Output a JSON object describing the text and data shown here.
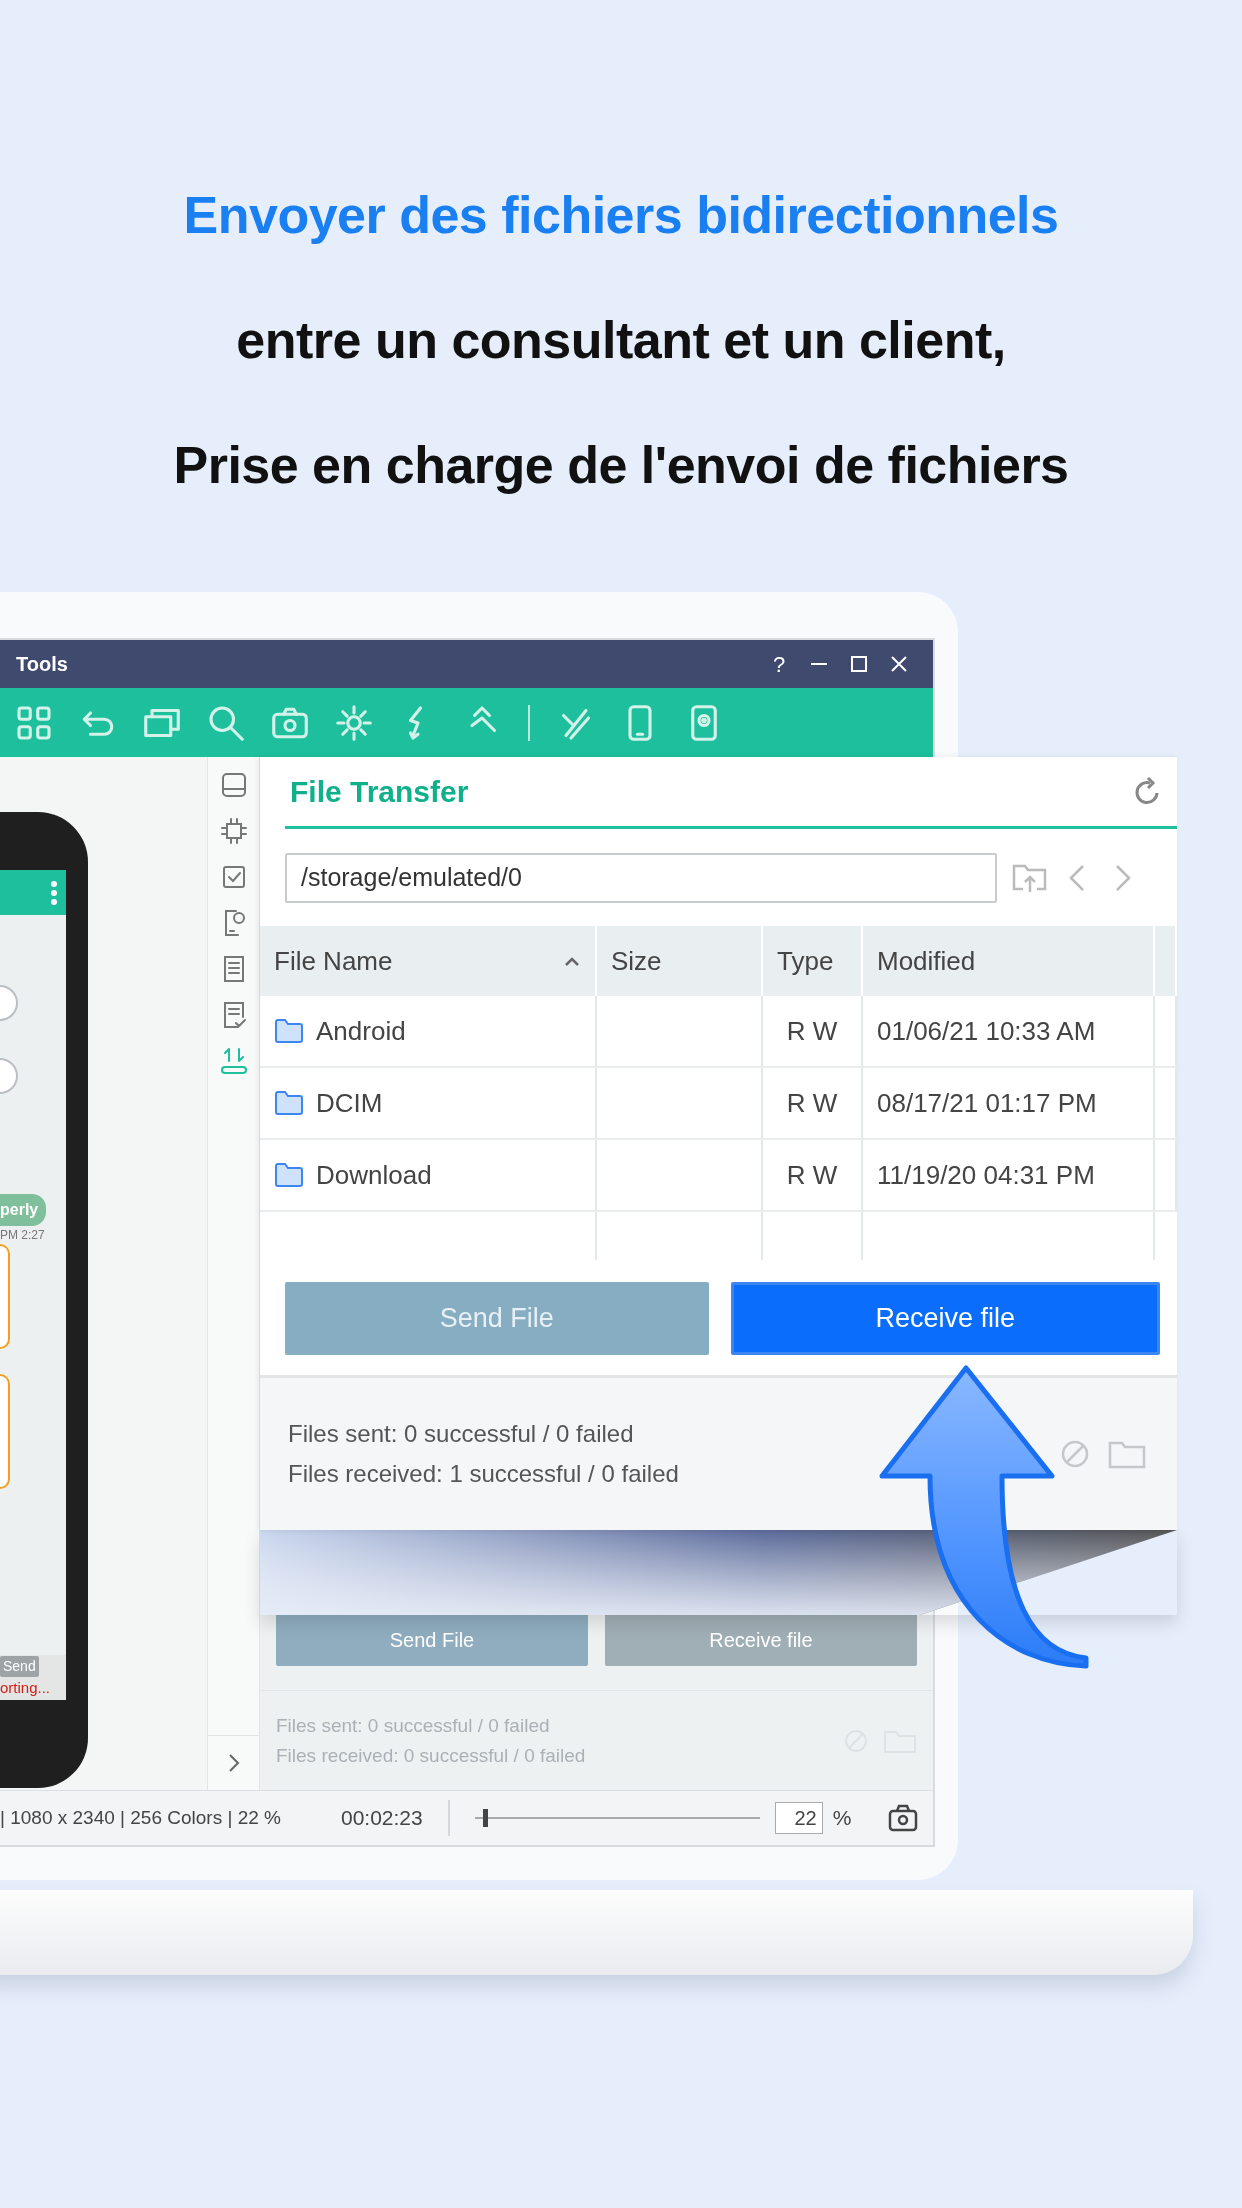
{
  "headline": [
    {
      "text": "Envoyer des fichiers bidirectionnels",
      "kind": "accent"
    },
    {
      "text": "entre un consultant et un client,",
      "kind": "plain"
    },
    {
      "text": "Prise en charge de l'envoi de fichiers",
      "kind": "plain"
    }
  ],
  "window": {
    "title": "Tools",
    "help": "?"
  },
  "phone": {
    "bubble": "perly",
    "time": "PM 2:27",
    "send_button": "Send",
    "status": "orting..."
  },
  "sidebar": [
    {
      "selected": false
    },
    {
      "selected": false
    },
    {
      "selected": false
    },
    {
      "selected": false
    },
    {
      "selected": false
    },
    {
      "selected": false
    },
    {
      "selected": true
    }
  ],
  "background_panel": {
    "buttons": [
      {
        "label": "Send File"
      },
      {
        "label": "Receive file"
      }
    ],
    "stats": [
      "Files sent: 0 successful / 0 failed",
      "Files received: 0 successful / 0 failed"
    ]
  },
  "file_transfer": {
    "title": "File Transfer",
    "path": "/storage/emulated/0",
    "columns": [
      {
        "label": "File Name",
        "sorted": true
      },
      {
        "label": "Size",
        "sorted": false
      },
      {
        "label": "Type",
        "sorted": false
      },
      {
        "label": "Modified",
        "sorted": false
      }
    ],
    "rows": [
      {
        "name": "Android",
        "size": "",
        "type": "R W",
        "modified": "01/06/21 10:33 AM"
      },
      {
        "name": "DCIM",
        "size": "",
        "type": "R W",
        "modified": "08/17/21 01:17 PM"
      },
      {
        "name": "Download",
        "size": "",
        "type": "R W",
        "modified": "11/19/20 04:31 PM"
      }
    ],
    "buttons": [
      {
        "label": "Send File",
        "kind": "secondary"
      },
      {
        "label": "Receive file",
        "kind": "primary"
      }
    ],
    "stats": [
      "Files sent: 0 successful / 0 failed",
      "Files received: 1 successful / 0 failed"
    ]
  },
  "status_bar": {
    "info": "| 1080 x 2340 | 256 Colors | 22 %",
    "elapsed": "00:02:23",
    "zoom": {
      "level": 0.03
    },
    "zoom_value": "22",
    "zoom_unit": "%"
  }
}
